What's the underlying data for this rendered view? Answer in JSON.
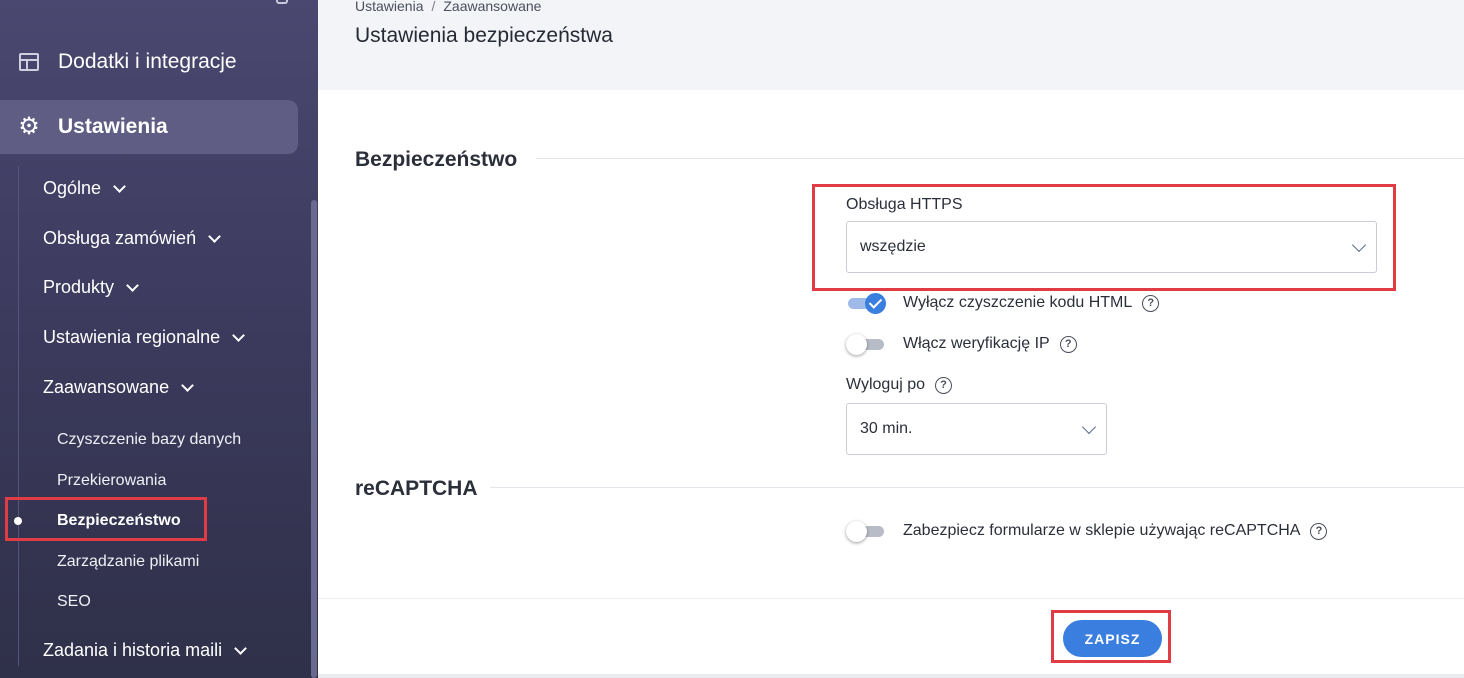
{
  "sidebar": {
    "addons_label": "Dodatki i integracje",
    "settings_label": "Ustawienia",
    "groups": [
      {
        "label": "Ogólne"
      },
      {
        "label": "Obsługa zamówień"
      },
      {
        "label": "Produkty"
      },
      {
        "label": "Ustawienia regionalne"
      },
      {
        "label": "Zaawansowane"
      },
      {
        "label": "Zadania i historia maili"
      }
    ],
    "advanced_items": [
      {
        "label": "Czyszczenie bazy danych"
      },
      {
        "label": "Przekierowania"
      },
      {
        "label": "Bezpieczeństwo",
        "active": true
      },
      {
        "label": "Zarządzanie plikami"
      },
      {
        "label": "SEO"
      }
    ]
  },
  "header": {
    "breadcrumb": [
      "Ustawienia",
      "Zaawansowane"
    ],
    "breadcrumb_sep": "/",
    "title": "Ustawienia bezpieczeństwa"
  },
  "security": {
    "section_title": "Bezpieczeństwo",
    "https_label": "Obsługa HTTPS",
    "https_value": "wszędzie",
    "disable_html_cleanup_label": "Wyłącz czyszczenie kodu HTML",
    "disable_html_cleanup_on": true,
    "ip_verification_label": "Włącz weryfikację IP",
    "ip_verification_on": false,
    "logout_label": "Wyloguj po",
    "logout_value": "30 min."
  },
  "recaptcha": {
    "section_title": "reCAPTCHA",
    "protect_forms_label": "Zabezpiecz formularze w sklepie używając reCAPTCHA",
    "protect_forms_on": false
  },
  "footer": {
    "save_label": "ZAPISZ"
  },
  "help_glyph": "?",
  "colors": {
    "accent": "#3a7ee0",
    "highlight": "#e03c45",
    "sidebar": "#3e3c60"
  }
}
